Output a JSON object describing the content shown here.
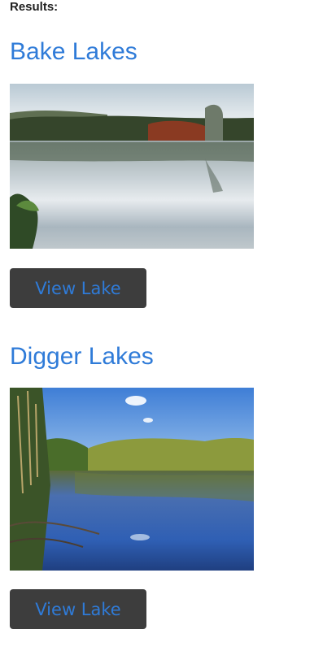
{
  "results": {
    "label": "Results:"
  },
  "lakes": [
    {
      "name": "Bake Lakes",
      "button_label": "View Lake"
    },
    {
      "name": "Digger Lakes",
      "button_label": "View Lake"
    }
  ],
  "colors": {
    "title": "#2f7bd8",
    "button_bg": "#3d3d3d",
    "button_text": "#2f7bd8"
  }
}
